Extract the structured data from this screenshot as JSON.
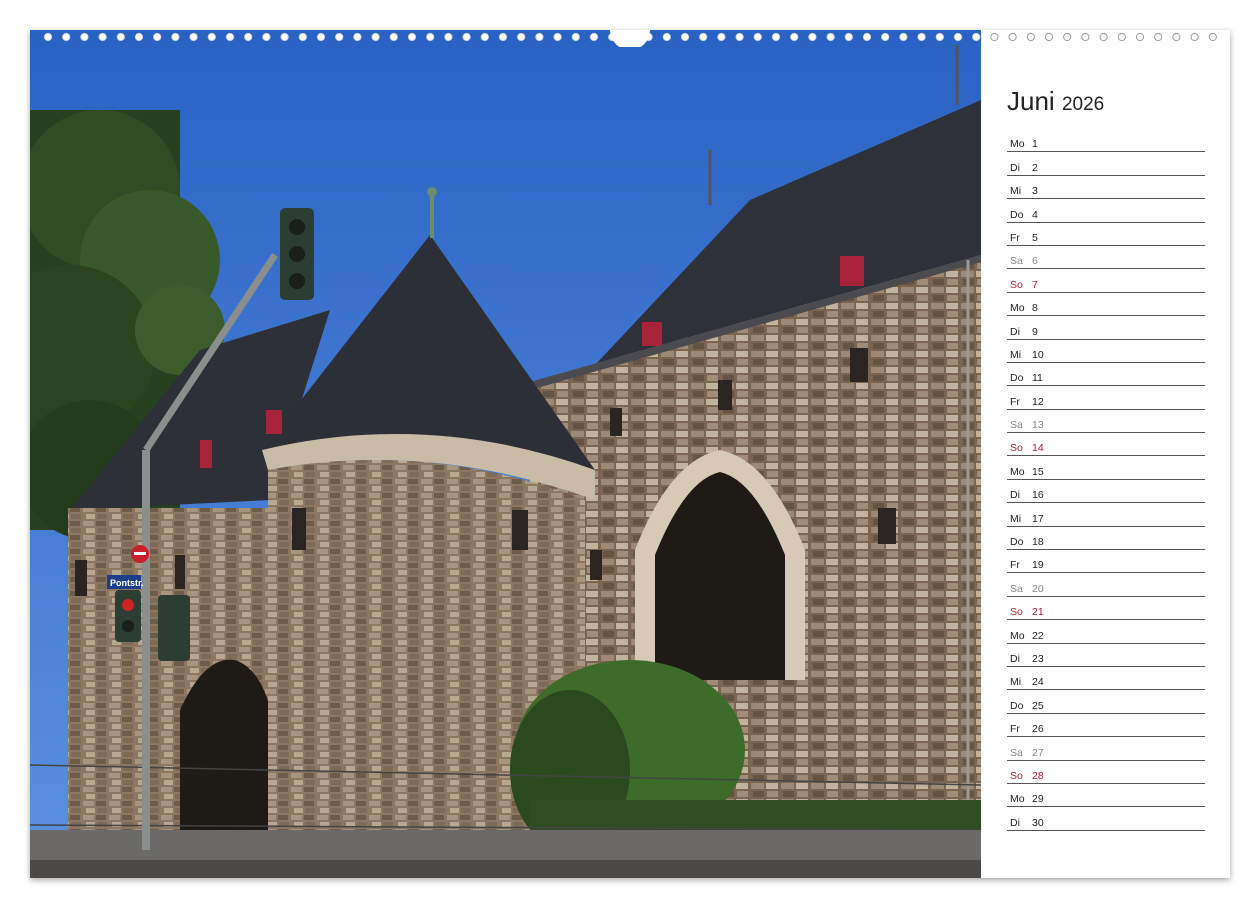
{
  "calendar": {
    "month": "Juni",
    "year": "2026",
    "days": [
      {
        "wd": "Mo",
        "d": "1",
        "type": "wk"
      },
      {
        "wd": "Di",
        "d": "2",
        "type": "wk"
      },
      {
        "wd": "Mi",
        "d": "3",
        "type": "wk"
      },
      {
        "wd": "Do",
        "d": "4",
        "type": "wk"
      },
      {
        "wd": "Fr",
        "d": "5",
        "type": "wk"
      },
      {
        "wd": "Sa",
        "d": "6",
        "type": "sat"
      },
      {
        "wd": "So",
        "d": "7",
        "type": "sun"
      },
      {
        "wd": "Mo",
        "d": "8",
        "type": "wk"
      },
      {
        "wd": "Di",
        "d": "9",
        "type": "wk"
      },
      {
        "wd": "Mi",
        "d": "10",
        "type": "wk"
      },
      {
        "wd": "Do",
        "d": "11",
        "type": "wk"
      },
      {
        "wd": "Fr",
        "d": "12",
        "type": "wk"
      },
      {
        "wd": "Sa",
        "d": "13",
        "type": "sat"
      },
      {
        "wd": "So",
        "d": "14",
        "type": "sun"
      },
      {
        "wd": "Mo",
        "d": "15",
        "type": "wk"
      },
      {
        "wd": "Di",
        "d": "16",
        "type": "wk"
      },
      {
        "wd": "Mi",
        "d": "17",
        "type": "wk"
      },
      {
        "wd": "Do",
        "d": "18",
        "type": "wk"
      },
      {
        "wd": "Fr",
        "d": "19",
        "type": "wk"
      },
      {
        "wd": "Sa",
        "d": "20",
        "type": "sat"
      },
      {
        "wd": "So",
        "d": "21",
        "type": "sun"
      },
      {
        "wd": "Mo",
        "d": "22",
        "type": "wk"
      },
      {
        "wd": "Di",
        "d": "23",
        "type": "wk"
      },
      {
        "wd": "Mi",
        "d": "24",
        "type": "wk"
      },
      {
        "wd": "Do",
        "d": "25",
        "type": "wk"
      },
      {
        "wd": "Fr",
        "d": "26",
        "type": "wk"
      },
      {
        "wd": "Sa",
        "d": "27",
        "type": "sat"
      },
      {
        "wd": "So",
        "d": "28",
        "type": "sun"
      },
      {
        "wd": "Mo",
        "d": "29",
        "type": "wk"
      },
      {
        "wd": "Di",
        "d": "30",
        "type": "wk"
      }
    ]
  },
  "photo": {
    "street_sign": "Pontstr.",
    "colors": {
      "sky": "#2f6fcf",
      "stone": "#8a7460",
      "roof": "#2f3138",
      "sunday": "#b2182b",
      "saturday": "#888888"
    }
  }
}
